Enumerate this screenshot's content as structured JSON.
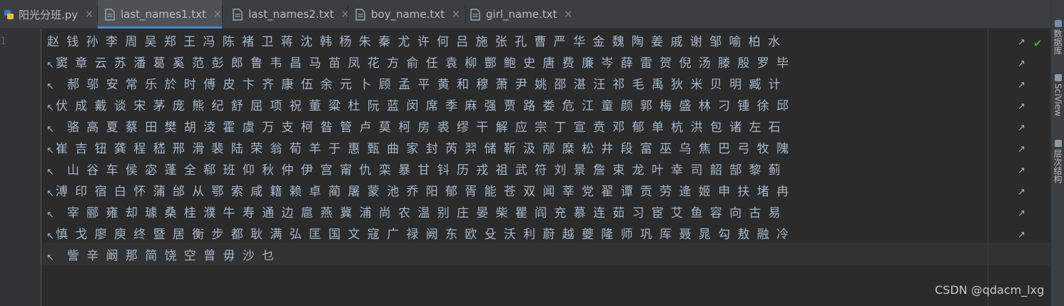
{
  "tabs": [
    {
      "label": "阳光分班.py",
      "icon": "python-file-icon",
      "active": false
    },
    {
      "label": "last_names1.txt",
      "icon": "text-file-icon",
      "active": true
    },
    {
      "label": "last_names2.txt",
      "icon": "text-file-icon",
      "active": false
    },
    {
      "label": "boy_name.txt",
      "icon": "text-file-icon",
      "active": false
    },
    {
      "label": "girl_name.txt",
      "icon": "text-file-icon",
      "active": false
    }
  ],
  "tab_close_glyph": "×",
  "gutter": {
    "line_number": "1"
  },
  "editor": {
    "wrap_start_glyph": "↖",
    "wrap_end_glyph": "↗",
    "check_glyph": "✔",
    "lines": [
      "赵钱孙李周吴郑王冯陈褚卫蒋沈韩杨朱秦尤许何吕施张孔曹严华金魏陶姜戚谢邹喻柏水",
      "窦章云苏潘葛奚范彭郎鲁韦昌马苗凤花方俞任袁柳酆鲍史唐费廉岑薛雷贺倪汤滕殷罗毕",
      "郝邬安常乐於时傅皮卞齐康伍余元卜顾孟平黄和穆萧尹姚邵湛汪祁毛禹狄米贝明臧计",
      "伏成戴谈宋茅庞熊纪舒屈项祝董粱杜阮蓝闵席季麻强贾路娄危江童颜郭梅盛林刁锺徐邱",
      "骆高夏蔡田樊胡淩霍虞万支柯昝管卢莫柯房裘缪干解应宗丁宣贲邓郁单杭洪包诸左石",
      "崔吉钮龚程嵇邢滑裴陆荣翁荀羊于惠甄曲家封芮羿储靳汲邴糜松井段富巫乌焦巴弓牧隗",
      "山谷车侯宓蓬全郗班仰秋仲伊宫甯仇栾暴甘钭历戎祖武符刘景詹束龙叶幸司韶郜黎蓟",
      "溥印宿白怀蒲邰从鄂索咸籍赖卓蔺屠蒙池乔阳郁胥能苍双闻莘党翟谭贡劳逄姬申扶堵冉",
      "宰郦雍却璩桑桂濮牛寿通边扈燕冀浦尚农温别庄晏柴瞿阎充慕连茹习宦艾鱼容向古易",
      "慎戈廖庾终暨居衡步都耿满弘匡国文寇广禄阙东欧殳沃利蔚越夔隆师巩厍聂晁勾敖融冷",
      "訾辛阚那简饶空曾毋沙乜"
    ]
  },
  "toolstrip": [
    {
      "label": "数据库",
      "icon": "database-icon"
    },
    {
      "label": "SciView",
      "icon": "sciview-icon"
    },
    {
      "label": "层次结构",
      "icon": "hierarchy-icon"
    }
  ],
  "watermark": "CSDN @qdacm_lxg",
  "colors": {
    "background": "#2b2b2b",
    "tab_bar": "#3c3f41",
    "active_tab": "#4e5254",
    "accent": "#4a88c7",
    "text": "#a9b7c6",
    "check": "#5c9b4e"
  }
}
